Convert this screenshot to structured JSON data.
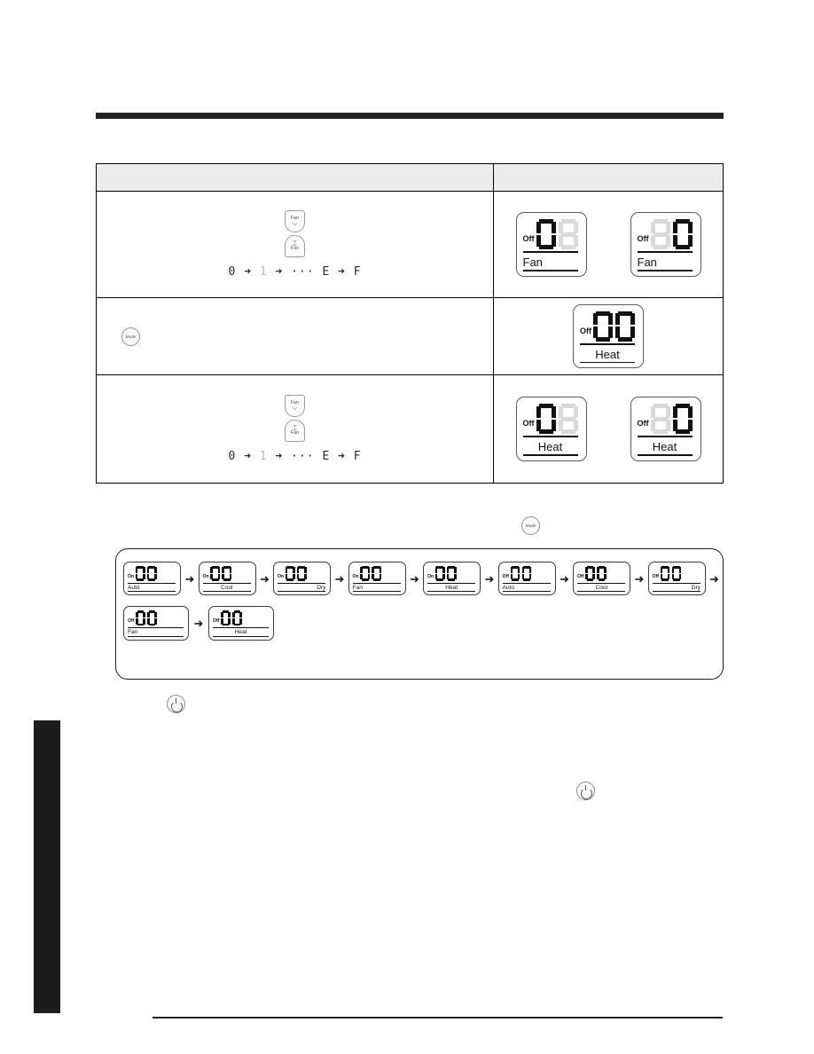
{
  "document": {
    "type": "appliance-manual-page",
    "top_rule": true,
    "bottom_rule": true,
    "side_tab": true
  },
  "table": {
    "header": {
      "left": "",
      "right": ""
    },
    "rows": [
      {
        "id": "row-fan-speed-off",
        "buttons": [
          {
            "name": "fan-down-button",
            "label": "Fan",
            "chevron": "down"
          },
          {
            "name": "fan-up-button",
            "label": "Fan",
            "chevron": "up"
          }
        ],
        "sequence": {
          "start": "0",
          "second": "1",
          "ellipsis": "···",
          "second_last": "E",
          "last": "F",
          "arrow": "➜"
        },
        "displays": [
          {
            "onoff": "Off",
            "digits": [
              "0",
              "blank"
            ],
            "label": "Fan",
            "label_align": "left"
          },
          {
            "onoff": "Off",
            "digits": [
              "blank",
              "0"
            ],
            "label": "Fan",
            "label_align": "left"
          }
        ]
      },
      {
        "id": "row-mode-button",
        "buttons": [
          {
            "name": "mode-button",
            "label": "Mode",
            "shape": "circle"
          }
        ],
        "sequence": null,
        "displays": [
          {
            "onoff": "Off",
            "digits": [
              "0",
              "0"
            ],
            "label": "Heat",
            "label_align": "center"
          }
        ]
      },
      {
        "id": "row-fan-speed-heat",
        "buttons": [
          {
            "name": "fan-down-button",
            "label": "Fan",
            "chevron": "down"
          },
          {
            "name": "fan-up-button",
            "label": "Fan",
            "chevron": "up"
          }
        ],
        "sequence": {
          "start": "0",
          "second": "1",
          "ellipsis": "···",
          "second_last": "E",
          "last": "F",
          "arrow": "➜"
        },
        "displays": [
          {
            "onoff": "Off",
            "digits": [
              "0",
              "blank"
            ],
            "label": "Heat",
            "label_align": "center"
          },
          {
            "onoff": "Off",
            "digits": [
              "blank",
              "0"
            ],
            "label": "Heat",
            "label_align": "center"
          }
        ]
      }
    ]
  },
  "flow": {
    "trigger_button": {
      "name": "mode-button",
      "label": "Mode"
    },
    "arrow": "➜",
    "row1": [
      {
        "onoff": "On",
        "digits": [
          "0",
          "0"
        ],
        "label": "Auto",
        "label_align": "left"
      },
      {
        "onoff": "On",
        "digits": [
          "0",
          "0"
        ],
        "label": "Cool",
        "label_align": "center"
      },
      {
        "onoff": "On",
        "digits": [
          "0",
          "0"
        ],
        "label": "Dry",
        "label_align": "right"
      },
      {
        "onoff": "On",
        "digits": [
          "0",
          "0"
        ],
        "label": "Fan",
        "label_align": "left"
      },
      {
        "onoff": "On",
        "digits": [
          "0",
          "0"
        ],
        "label": "Heat",
        "label_align": "center"
      },
      {
        "onoff": "Off",
        "digits": [
          "0",
          "0"
        ],
        "label": "Auto",
        "label_align": "left"
      },
      {
        "onoff": "Off",
        "digits": [
          "0",
          "0"
        ],
        "label": "Cool",
        "label_align": "center"
      },
      {
        "onoff": "Off",
        "digits": [
          "0",
          "0"
        ],
        "label": "Dry",
        "label_align": "right"
      }
    ],
    "row2": [
      {
        "onoff": "Off",
        "digits": [
          "0",
          "0"
        ],
        "label": "Fan",
        "label_align": "left"
      },
      {
        "onoff": "Off",
        "digits": [
          "0",
          "0"
        ],
        "label": "Heat",
        "label_align": "center"
      }
    ]
  },
  "power_buttons": [
    {
      "name": "power-button-upper",
      "glyph": "power"
    },
    {
      "name": "power-button-lower",
      "glyph": "power"
    }
  ]
}
